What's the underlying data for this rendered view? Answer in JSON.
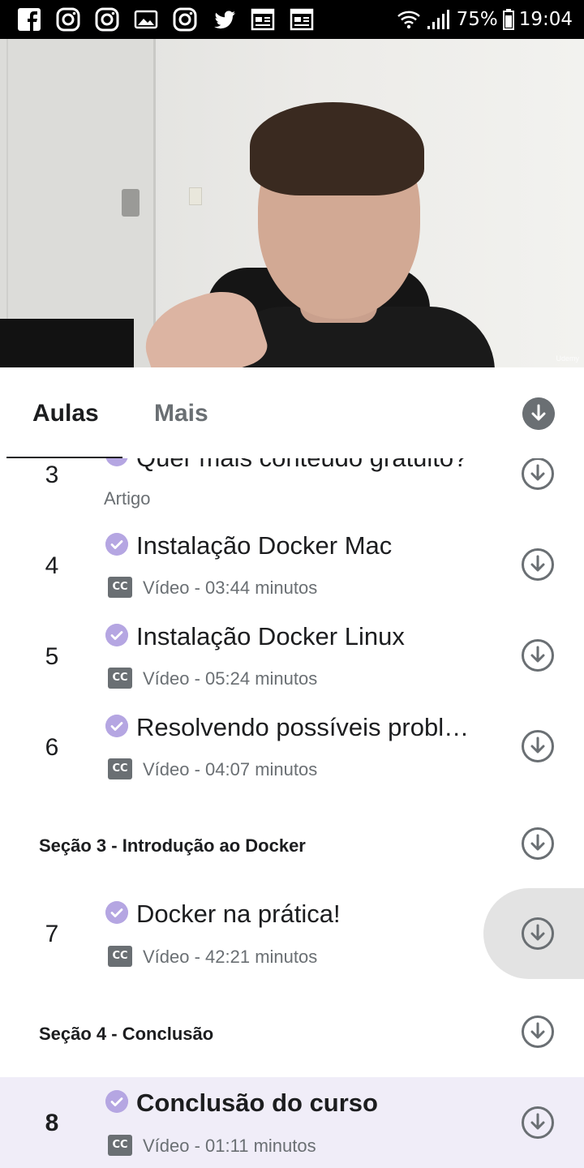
{
  "status_bar": {
    "battery": "75%",
    "time": "19:04",
    "left_icons": [
      "facebook-icon",
      "instagram-icon",
      "instagram-icon",
      "gallery-icon",
      "instagram-icon",
      "twitter-icon",
      "news-icon",
      "news-icon"
    ]
  },
  "video": {
    "watermark": "Udemy"
  },
  "tabs": {
    "lessons": "Aulas",
    "more": "Mais"
  },
  "lessons": [
    {
      "number": "3",
      "title": "Quer mais conteúdo gratuito?",
      "meta": "Artigo"
    },
    {
      "number": "4",
      "title": "Instalação Docker Mac",
      "meta": "Vídeo - 03:44 minutos"
    },
    {
      "number": "5",
      "title": "Instalação Docker Linux",
      "meta": "Vídeo - 05:24 minutos"
    },
    {
      "number": "6",
      "title": "Resolvendo possíveis probl…",
      "meta": "Vídeo - 04:07 minutos"
    },
    {
      "number": "7",
      "title": "Docker na prática!",
      "meta": "Vídeo - 42:21 minutos"
    },
    {
      "number": "8",
      "title": "Conclusão do curso",
      "meta": "Vídeo - 01:11 minutos"
    }
  ],
  "sections": [
    {
      "title": "Seção 3 - Introdução ao Docker"
    },
    {
      "title": "Seção 4 - Conclusão"
    }
  ],
  "cc_label": "CC",
  "colors": {
    "accent_check": "#b5a6e2",
    "current_row": "#f0edf8",
    "icon_gray": "#6a6f73"
  }
}
